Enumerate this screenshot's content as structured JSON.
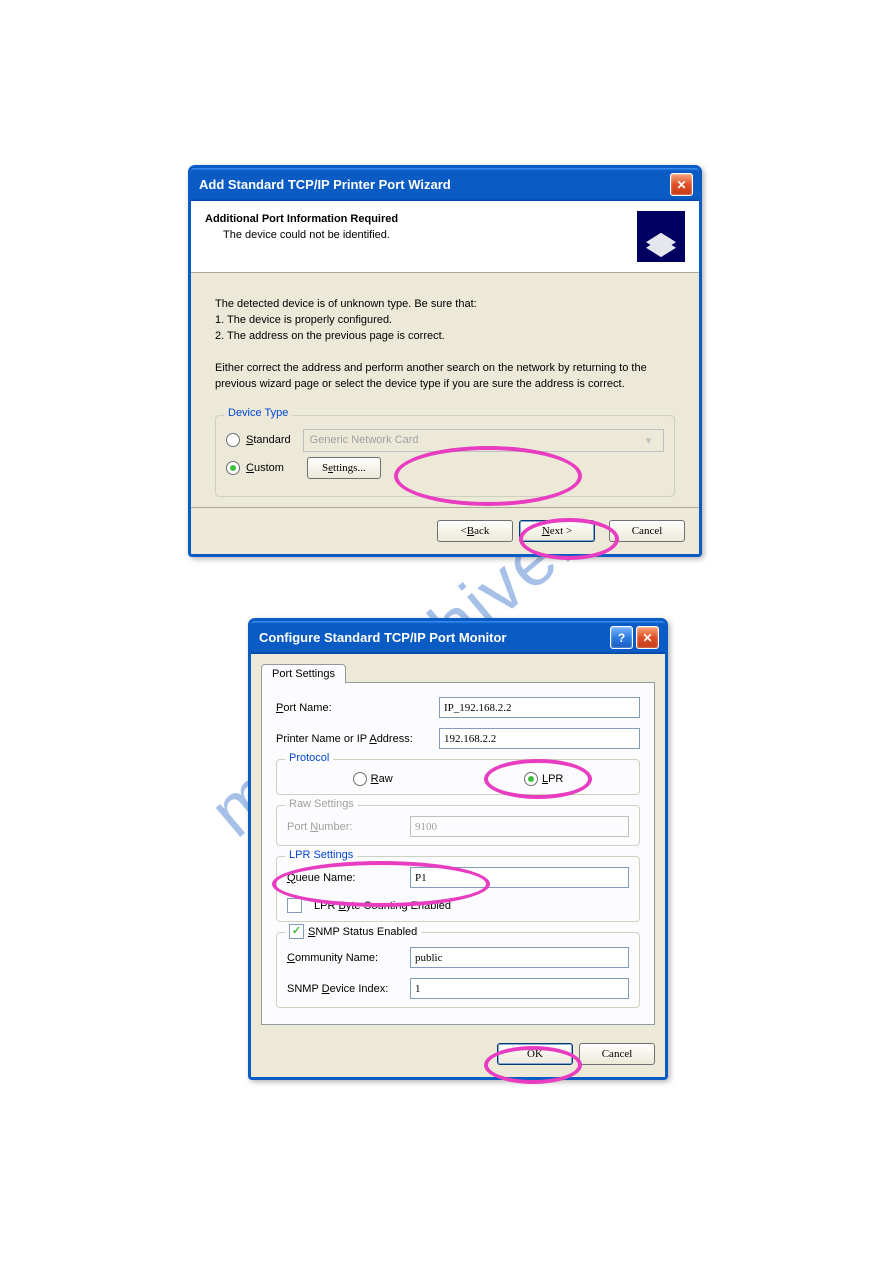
{
  "watermark": "manualshive.com",
  "dialog1": {
    "title": "Add Standard TCP/IP Printer Port Wizard",
    "header_title": "Additional Port Information Required",
    "header_subtitle": "The device could not be identified.",
    "body_text_1": "The detected device is of unknown type.  Be sure that:",
    "body_text_2": "1. The device is properly configured.",
    "body_text_3": "2.  The address on the previous page is correct.",
    "body_text_4": "Either correct the address and perform another search on the network by returning to the previous wizard page or select the device type if you are sure the address is correct.",
    "device_type": {
      "legend": "Device Type",
      "standard_label": "Standard",
      "dropdown_text": "Generic Network Card",
      "custom_label": "Custom",
      "settings_btn": "Settings..."
    },
    "footer": {
      "back": "< Back",
      "next": "Next >",
      "cancel": "Cancel"
    }
  },
  "dialog2": {
    "title": "Configure Standard TCP/IP Port Monitor",
    "tab": "Port Settings",
    "port_name": {
      "label": "Port Name:",
      "value": "IP_192.168.2.2"
    },
    "printer_addr": {
      "label": "Printer Name or IP Address:",
      "value": "192.168.2.2"
    },
    "protocol": {
      "legend": "Protocol",
      "raw": "Raw",
      "lpr": "LPR"
    },
    "raw_settings": {
      "legend": "Raw Settings",
      "port_number_label": "Port Number:",
      "port_number_value": "9100"
    },
    "lpr_settings": {
      "legend": "LPR Settings",
      "queue_label": "Queue Name:",
      "queue_value": "P1",
      "byte_counting": "LPR Byte Counting Enabled"
    },
    "snmp": {
      "enabled": "SNMP Status Enabled",
      "community_label": "Community Name:",
      "community_value": "public",
      "index_label": "SNMP Device Index:",
      "index_value": "1"
    },
    "footer": {
      "ok": "OK",
      "cancel": "Cancel"
    }
  }
}
